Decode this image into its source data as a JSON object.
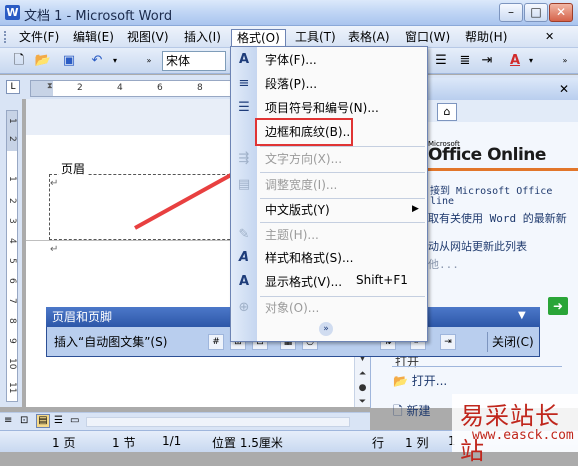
{
  "window": {
    "title": "文档 1 - Microsoft Word"
  },
  "menubar": {
    "items": [
      "文件(F)",
      "编辑(E)",
      "视图(V)",
      "插入(I)",
      "格式(O)",
      "工具(T)",
      "表格(A)",
      "窗口(W)",
      "帮助(H)"
    ],
    "active": "格式(O)"
  },
  "toolbar": {
    "font_name": "宋体"
  },
  "ruler": {
    "numbers": [
      "2",
      "4",
      "6",
      "8",
      "10",
      "12",
      "14"
    ]
  },
  "vruler": {
    "numbers": [
      "1",
      "2",
      "1",
      "2",
      "3",
      "4",
      "5",
      "6",
      "7",
      "8",
      "9",
      "10",
      "11"
    ]
  },
  "document": {
    "header_label": "页眉",
    "para_mark": "↵"
  },
  "format_menu": {
    "items": [
      {
        "label": "字体(F)...",
        "enabled": true,
        "icon": "A"
      },
      {
        "label": "段落(P)...",
        "enabled": true,
        "icon": "≡"
      },
      {
        "label": "项目符号和编号(N)...",
        "enabled": true,
        "icon": "☰"
      },
      {
        "label": "边框和底纹(B)...",
        "enabled": true,
        "icon": ""
      },
      {
        "label": "文字方向(X)...",
        "enabled": false,
        "icon": "⇶"
      },
      {
        "label": "调整宽度(I)...",
        "enabled": false,
        "icon": "▤"
      },
      {
        "label": "中文版式(Y)",
        "enabled": true,
        "icon": ""
      },
      {
        "label": "主题(H)...",
        "enabled": false,
        "icon": "✎"
      },
      {
        "label": "样式和格式(S)...",
        "enabled": true,
        "icon": "A"
      },
      {
        "label": "显示格式(V)...",
        "enabled": true,
        "icon": "A"
      },
      {
        "label": "对象(O)...",
        "enabled": false,
        "icon": "⊕"
      }
    ],
    "shortcut_display_format": "Shift+F1",
    "submenu_arrow": "▶",
    "expand_icon": "»"
  },
  "taskpane": {
    "brand_small": "Microsoft",
    "brand": "Office Online",
    "lines": [
      "接到 Microsoft Office",
      "line",
      "取有关使用 Word 的最新新",
      "动从网站更新此列表",
      "他..."
    ],
    "open_heading": "打开",
    "open_link": "打开...",
    "new_link": "新建"
  },
  "hf_toolbar": {
    "title": "页眉和页脚",
    "insert_autotext": "插入“自动图文集”(S)",
    "close": "关闭(C)"
  },
  "status": {
    "page": "1 页",
    "section": "1 节",
    "page_of": "1/1",
    "position": "位置 1.5厘米",
    "line": "行",
    "column": "1 列",
    "extra": "1"
  },
  "watermark": {
    "site": "易采站长站",
    "url": "www.easck.com"
  }
}
